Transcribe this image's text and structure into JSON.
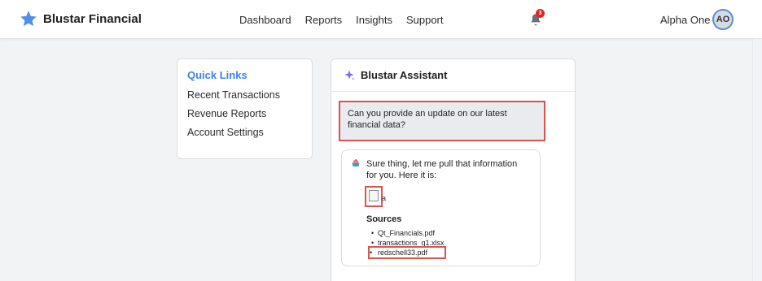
{
  "header": {
    "brand_name": "Blustar Financial",
    "brand_icon": "star-icon",
    "nav": [
      "Dashboard",
      "Reports",
      "Insights",
      "Support"
    ],
    "notifications_count": "3",
    "user_name": "Alpha One",
    "avatar_initials": "AO"
  },
  "quick_links": {
    "title": "Quick Links",
    "items": [
      "Recent Transactions",
      "Revenue Reports",
      "Account Settings"
    ]
  },
  "assistant": {
    "title": "Blustar Assistant",
    "user_message": "Can you provide an update on our latest financial data?",
    "bot_message": "Sure thing, let me pull that information for you. Here it is:",
    "attachment_label": "a",
    "sources_title": "Sources",
    "sources": [
      "Qt_Financials.pdf",
      "transactions_q1.xlsx",
      "redschell33.pdf"
    ]
  },
  "colors": {
    "accent": "#3b82f6",
    "highlight_border": "#d9534f",
    "badge": "#e02424"
  }
}
